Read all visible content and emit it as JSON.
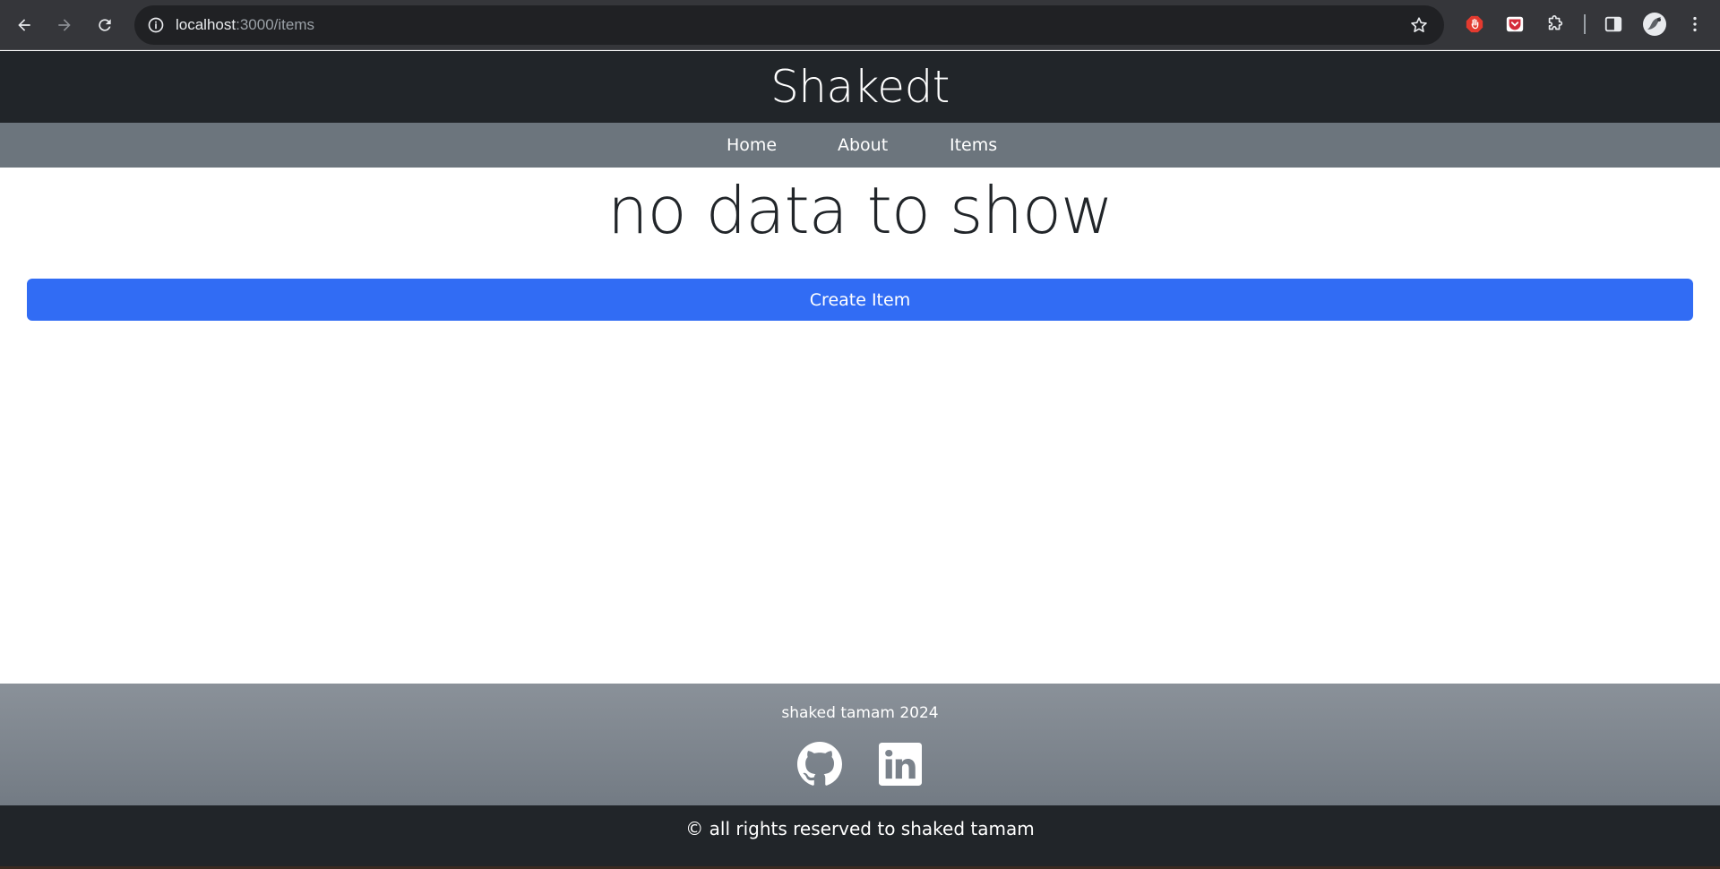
{
  "browser": {
    "url_host": "localhost",
    "url_rest": ":3000/items",
    "icons": [
      "back-icon",
      "forward-icon",
      "reload-icon",
      "site-info-icon",
      "bookmark-star-icon",
      "adblock-extension-icon",
      "pocket-extension-icon",
      "extensions-puzzle-icon",
      "side-panel-icon",
      "profile-avatar-icon",
      "browser-menu-icon"
    ]
  },
  "header": {
    "title": "Shakedt"
  },
  "nav": {
    "items": [
      {
        "label": "Home"
      },
      {
        "label": "About"
      },
      {
        "label": "Items"
      }
    ]
  },
  "main": {
    "empty_message": "no data to show",
    "create_button_label": "Create Item"
  },
  "footer": {
    "credit": "shaked tamam 2024",
    "social": [
      "github-icon",
      "linkedin-icon"
    ],
    "copyright": "© all rights reserved to shaked tamam"
  },
  "colors": {
    "header_bg": "#212529",
    "nav_bg": "#6c757d",
    "primary_button": "#316cf4",
    "footer_bg": "#7d848c"
  }
}
